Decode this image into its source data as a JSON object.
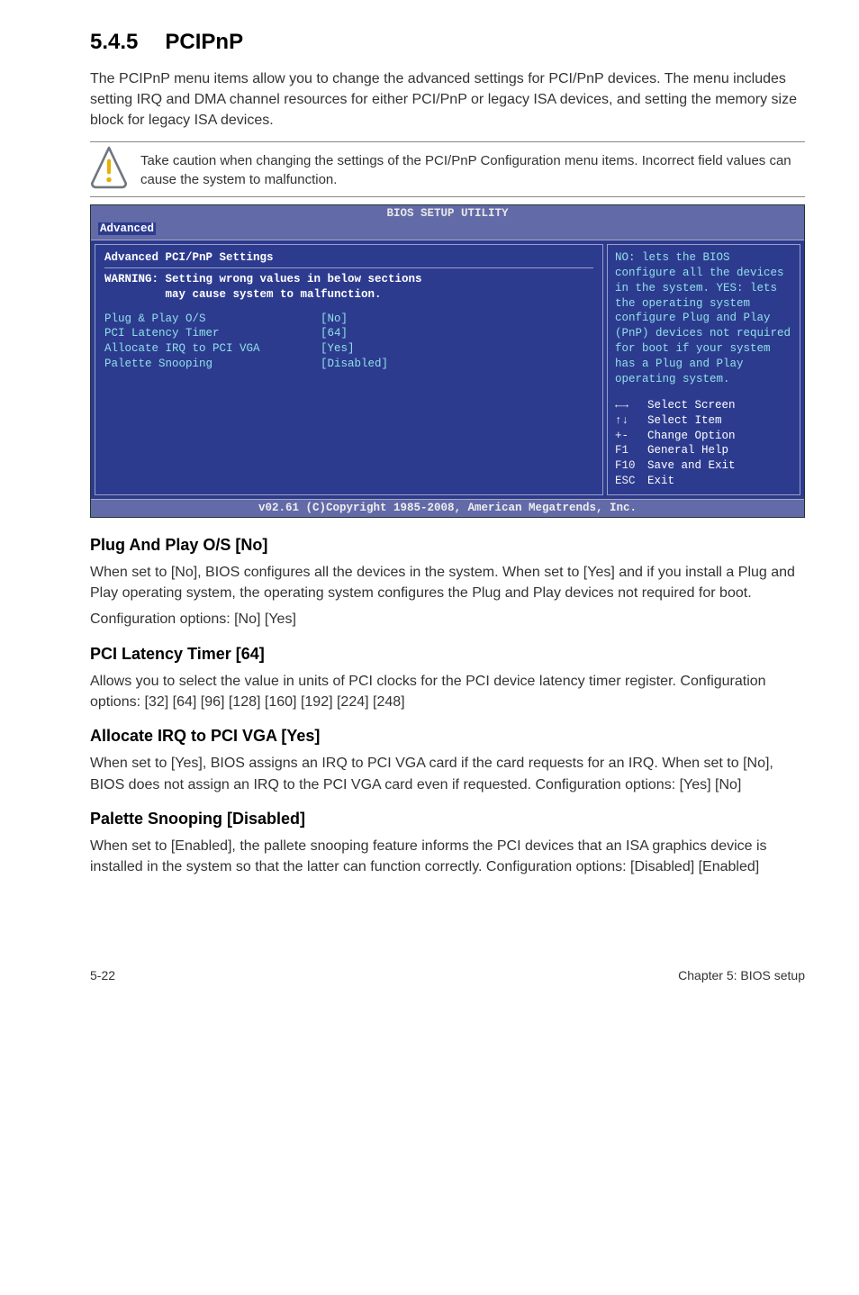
{
  "heading": {
    "number": "5.4.5",
    "title": "PCIPnP"
  },
  "intro": "The PCIPnP menu items allow you to change the advanced settings for PCI/PnP devices. The menu includes setting IRQ and DMA channel resources for either PCI/PnP or legacy ISA devices, and setting the memory size block for legacy ISA devices.",
  "caution": "Take caution when changing the settings of the PCI/PnP Configuration menu items. Incorrect field values can cause the system to malfunction.",
  "bios": {
    "header_title": "BIOS SETUP UTILITY",
    "tab": "Advanced",
    "panel_title": "Advanced PCI/PnP Settings",
    "warning_l1": "WARNING: Setting wrong values in below sections",
    "warning_l2": "         may cause system to malfunction.",
    "opts": [
      {
        "label": "Plug & Play O/S",
        "value": "[No]"
      },
      {
        "label": "PCI Latency Timer",
        "value": "[64]"
      },
      {
        "label": "Allocate IRQ to PCI VGA",
        "value": "[Yes]"
      },
      {
        "label": "Palette Snooping",
        "value": "[Disabled]"
      }
    ],
    "help": "NO: lets the BIOS configure all the devices in the system. YES: lets the operating system configure Plug and Play (PnP) devices not required for boot if your system has a Plug and Play operating system.",
    "keys": {
      "k1": "←→",
      "v1": "Select Screen",
      "k2": "↑↓",
      "v2": "Select Item",
      "k3": "+-",
      "v3": "Change Option",
      "k4": "F1",
      "v4": "General Help",
      "k5": "F10",
      "v5": "Save and Exit",
      "k6": "ESC",
      "v6": "Exit"
    },
    "footer": "v02.61 (C)Copyright 1985-2008, American Megatrends, Inc."
  },
  "sections": {
    "s1": {
      "title": "Plug And Play O/S [No]",
      "p1": "When set to [No], BIOS configures all the devices in the system. When set to [Yes] and if you install a Plug and Play operating system, the operating system configures the Plug and Play devices not required for boot.",
      "p2": "Configuration options: [No] [Yes]"
    },
    "s2": {
      "title": "PCI Latency Timer [64]",
      "p1": "Allows you to select the value in units of PCI clocks for the PCI device latency timer register. Configuration options: [32] [64] [96] [128] [160] [192] [224] [248]"
    },
    "s3": {
      "title": "Allocate IRQ to PCI VGA [Yes]",
      "p1": "When set to [Yes], BIOS assigns an IRQ to PCI VGA card if the card requests for an IRQ. When set to [No], BIOS does not assign an IRQ to the PCI VGA card even if requested. Configuration options: [Yes] [No]"
    },
    "s4": {
      "title": "Palette Snooping [Disabled]",
      "p1": "When set to [Enabled], the pallete snooping feature informs the PCI devices that an ISA graphics device is installed in the system so that the latter can function correctly. Configuration options: [Disabled] [Enabled]"
    }
  },
  "footer": {
    "left": "5-22",
    "right": "Chapter 5: BIOS setup"
  }
}
